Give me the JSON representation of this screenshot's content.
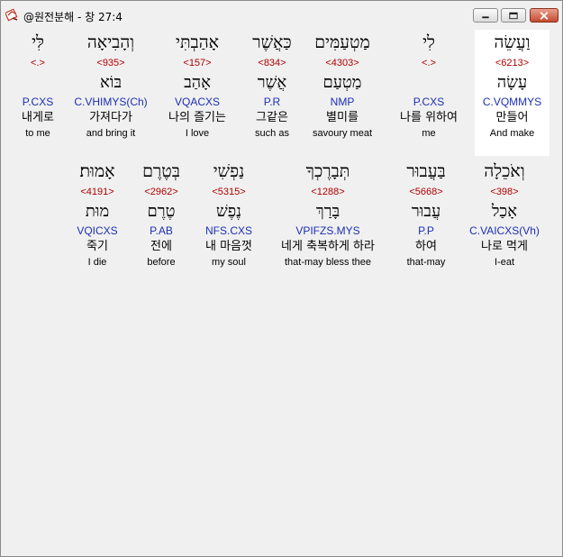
{
  "window": {
    "title": "@원전분해 - 창 27:4",
    "icon": "bible-app-icon",
    "controls": [
      "minimize-icon",
      "maximize-icon",
      "close-icon"
    ]
  },
  "row1": [
    {
      "hebrew": "וַעֲשֵׂה",
      "strong": "<6213>",
      "lemma": "עָשָׂה",
      "parse": "C.VQMMYS",
      "korean": "만들어",
      "english": "And make",
      "highlighted": true
    },
    {
      "hebrew": "לִי",
      "strong": "<.>",
      "lemma": "",
      "parse": "P.CXS",
      "korean": "나를 위하여",
      "english": "me"
    },
    {
      "hebrew": "מַטְעַמִּים",
      "strong": "<4303>",
      "lemma": "מַטְעַם",
      "parse": "NMP",
      "korean": "별미를",
      "english": "savoury meat"
    },
    {
      "hebrew": "כַּאֲשֶׁר",
      "strong": "<834>",
      "lemma": "אֲשֶׁר",
      "parse": "P.R",
      "korean": "그같은",
      "english": "such as"
    },
    {
      "hebrew": "אָהַבְתִּי",
      "strong": "<157>",
      "lemma": "אָהַב",
      "parse": "VQACXS",
      "korean": "나의 즐기는",
      "english": "I love"
    },
    {
      "hebrew": "וְהָבִיאָה",
      "strong": "<935>",
      "lemma": "בּוֹא",
      "parse": "C.VHIMYS(Ch)",
      "korean": "가져다가",
      "english": "and bring it"
    },
    {
      "hebrew": "לִּי",
      "strong": "<.>",
      "lemma": "",
      "parse": "P.CXS",
      "korean": "내게로",
      "english": "to me"
    }
  ],
  "row2": [
    {
      "hebrew": "וְאֹכֵלָה",
      "strong": "<398>",
      "lemma": "אָכַל",
      "parse": "C.VAICXS(Vh)",
      "korean": "나로 먹게",
      "english": "I-eat"
    },
    {
      "hebrew": "בַּעֲבוּר",
      "strong": "<5668>",
      "lemma": "עֲבוּר",
      "parse": "P.P",
      "korean": "하여",
      "english": "that-may"
    },
    {
      "hebrew": "תְּבָרֶכְךָ",
      "strong": "<1288>",
      "lemma": "בָּרַךְ",
      "parse": "VPIFZS.MYS",
      "korean": "네게 축복하게 하라",
      "english": "that-may bless thee"
    },
    {
      "hebrew": "נַפְשִׁי",
      "strong": "<5315>",
      "lemma": "נֶפֶשׁ",
      "parse": "NFS.CXS",
      "korean": "내 마음껏",
      "english": "my soul"
    },
    {
      "hebrew": "בְּטֶרֶם",
      "strong": "<2962>",
      "lemma": "טֶרֶם",
      "parse": "P.AB",
      "korean": "전에",
      "english": "before"
    },
    {
      "hebrew": "אָמוּת׃",
      "strong": "<4191>",
      "lemma": "מוּת",
      "parse": "VQICXS",
      "korean": "죽기",
      "english": "I die"
    }
  ],
  "colors": {
    "strong": "#b00000",
    "parse": "#1c2fb3",
    "background": "#f0f0f0",
    "highlight": "#ffffff"
  }
}
